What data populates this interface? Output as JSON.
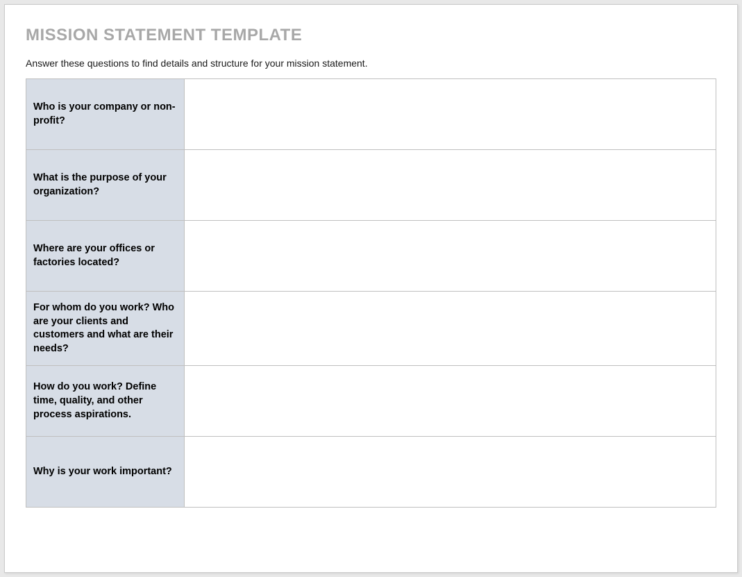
{
  "title": "MISSION STATEMENT TEMPLATE",
  "instructions": "Answer these questions to find details and structure for your mission statement.",
  "rows": [
    {
      "question": "Who is your company or non-profit?",
      "answer": ""
    },
    {
      "question": "What is the purpose of your organization?",
      "answer": ""
    },
    {
      "question": "Where are your offices or factories located?",
      "answer": ""
    },
    {
      "question": "For whom do you work? Who are your clients and customers and what are their needs?",
      "answer": ""
    },
    {
      "question": "How do you work? Define time, quality, and other process aspirations.",
      "answer": ""
    },
    {
      "question": "Why is your work important?",
      "answer": ""
    }
  ]
}
